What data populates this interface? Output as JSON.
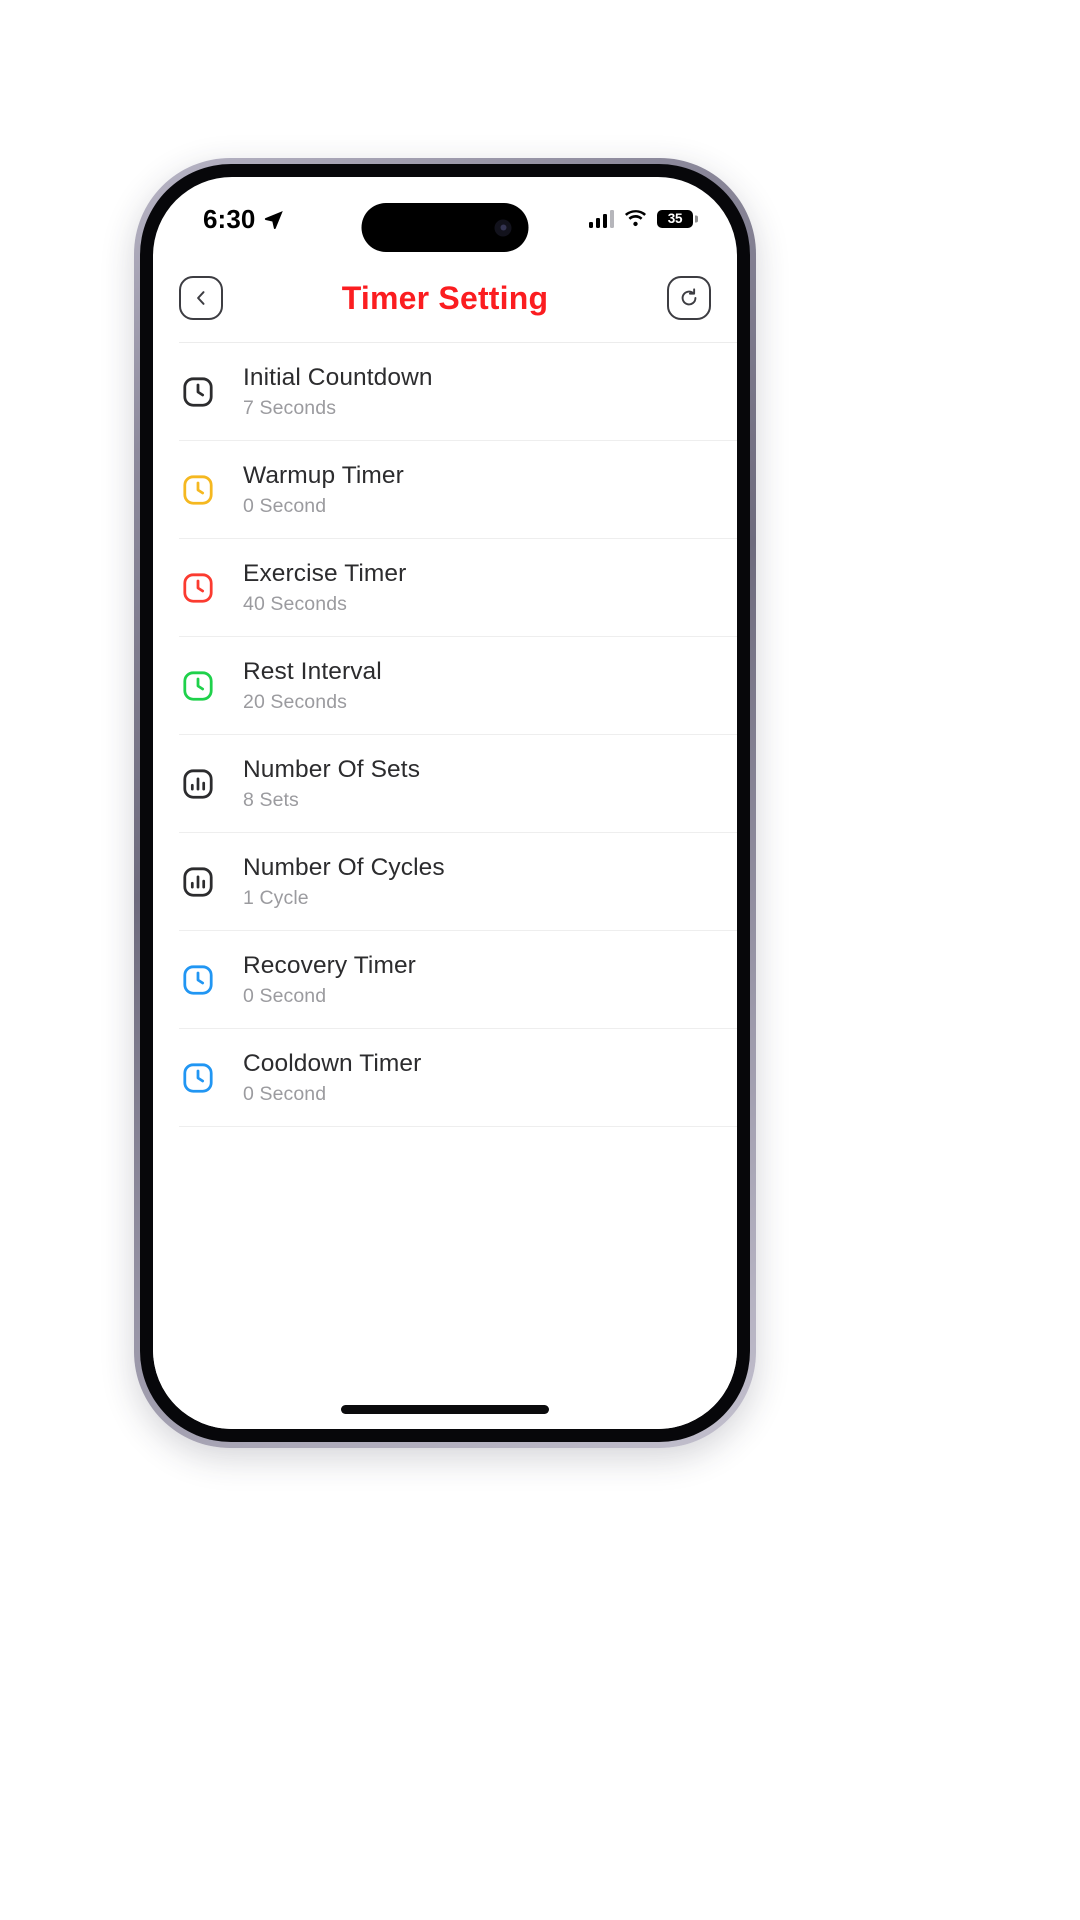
{
  "status_bar": {
    "time": "6:30",
    "location_icon": "location-arrow-icon",
    "cellular_icon": "cellular-signal-icon",
    "wifi_icon": "wifi-icon",
    "battery_level": "35",
    "battery_icon": "battery-icon"
  },
  "nav": {
    "back_icon": "chevron-left-icon",
    "title": "Timer Setting",
    "reset_icon": "reset-circular-arrow-icon",
    "title_color": "#fb1d20"
  },
  "colors": {
    "accent_red": "#fb1d20",
    "icon_dark": "#2c2c2e",
    "icon_yellow": "#f5b820",
    "icon_red": "#fb3b30",
    "icon_green": "#1fd14b",
    "icon_blue": "#2196f3",
    "subtitle": "#9b9b9f",
    "separator": "#eeeeee"
  },
  "settings_rows": [
    {
      "title": "Initial Countdown",
      "value": "7 Seconds",
      "icon": "clock-icon",
      "icon_color": "#2c2c2e"
    },
    {
      "title": "Warmup Timer",
      "value": "0 Second",
      "icon": "clock-icon",
      "icon_color": "#f5b820"
    },
    {
      "title": "Exercise Timer",
      "value": "40 Seconds",
      "icon": "clock-icon",
      "icon_color": "#fb3b30"
    },
    {
      "title": "Rest Interval",
      "value": "20 Seconds",
      "icon": "clock-icon",
      "icon_color": "#1fd14b"
    },
    {
      "title": "Number Of Sets",
      "value": "8 Sets",
      "icon": "bar-chart-icon",
      "icon_color": "#2c2c2e"
    },
    {
      "title": "Number Of Cycles",
      "value": "1 Cycle",
      "icon": "bar-chart-icon",
      "icon_color": "#2c2c2e"
    },
    {
      "title": "Recovery Timer",
      "value": "0 Second",
      "icon": "clock-icon",
      "icon_color": "#2196f3"
    },
    {
      "title": "Cooldown Timer",
      "value": "0 Second",
      "icon": "clock-icon",
      "icon_color": "#2196f3"
    }
  ]
}
